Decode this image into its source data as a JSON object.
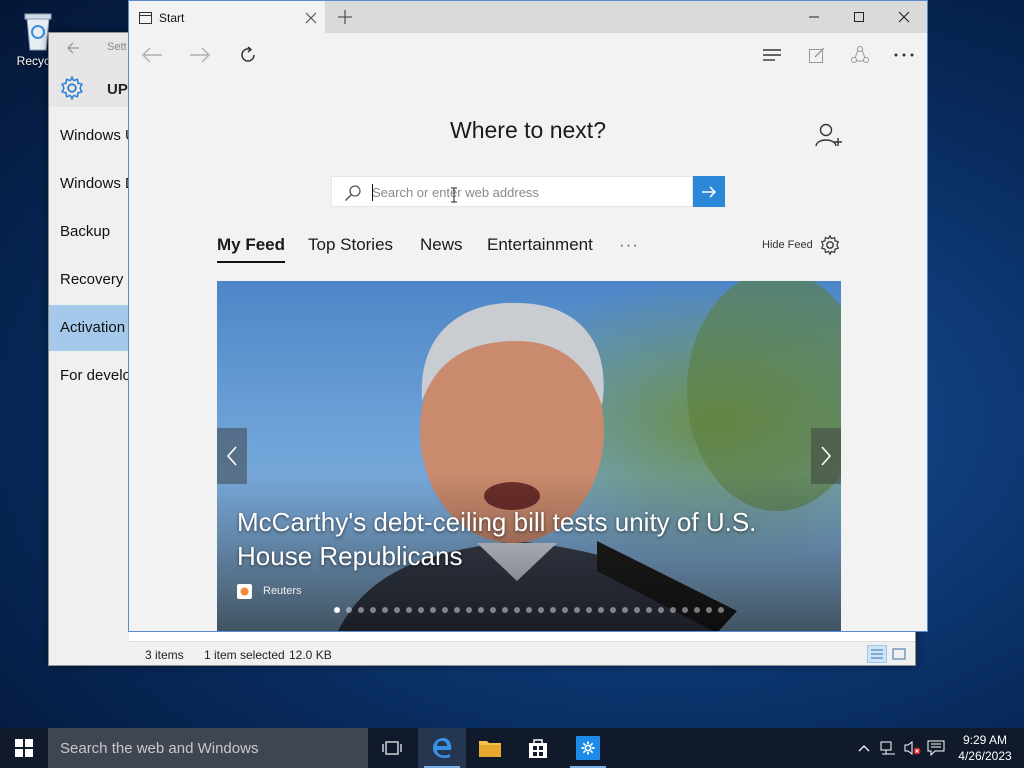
{
  "desktop": {
    "recycle_label": "Recycle"
  },
  "settings": {
    "title": "Sett",
    "header": "UP",
    "nav": [
      "Windows U",
      "Windows D",
      "Backup",
      "Recovery",
      "Activation",
      "For develo"
    ],
    "status": {
      "items": "3 items",
      "selected": "1 item selected",
      "size": "12.0 KB"
    }
  },
  "browser": {
    "tab_title": "Start",
    "heading": "Where to next?",
    "search": {
      "placeholder": "Search or enter web address",
      "value": ""
    },
    "feed_tabs": [
      "My Feed",
      "Top Stories",
      "News",
      "Entertainment"
    ],
    "more": "···",
    "hide_feed": "Hide Feed",
    "hero": {
      "headline": "McCarthy's debt-ceiling bill tests unity of U.S. House Republicans",
      "source": "Reuters",
      "slide_count": 33,
      "current_slide": 1
    }
  },
  "taskbar": {
    "search_placeholder": "Search the web and Windows",
    "time": "9:29 AM",
    "date": "4/26/2023"
  },
  "colors": {
    "accent": "#2b87d8",
    "active_nav": "#a5c9ea",
    "taskbar": "#101a2a"
  }
}
